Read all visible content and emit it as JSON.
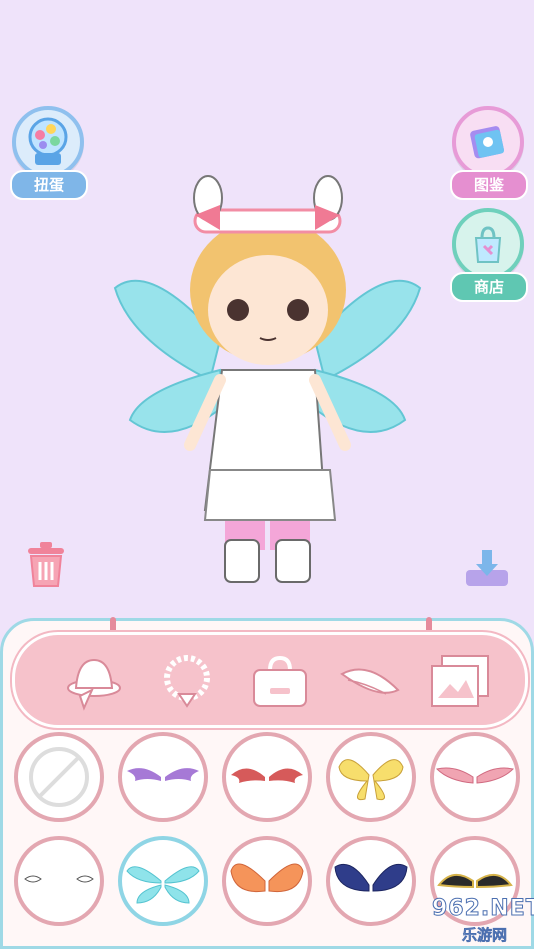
{
  "side_buttons": {
    "gacha_label": "扭蛋",
    "collection_label": "图鉴",
    "shop_label": "商店"
  },
  "categories": [
    "hat-icon",
    "necklace-icon",
    "bag-icon",
    "wings-icon",
    "background-icon"
  ],
  "items": [
    {
      "icon": "none-icon"
    },
    {
      "icon": "purple-bat-wings-icon"
    },
    {
      "icon": "red-bat-wings-icon"
    },
    {
      "icon": "yellow-butterfly-wings-icon"
    },
    {
      "icon": "pink-feather-wings-icon"
    },
    {
      "icon": "white-small-wings-icon"
    },
    {
      "icon": "cyan-fairy-wings-icon",
      "selected": true
    },
    {
      "icon": "orange-fairy-wings-icon"
    },
    {
      "icon": "navy-feather-wings-icon"
    },
    {
      "icon": "black-gold-wings-icon"
    }
  ],
  "watermark": {
    "brand": "962.NET",
    "sub": "乐游网"
  },
  "colors": {
    "background": "#efe3fa",
    "panel_border": "#9fd9e6",
    "category_bar": "#f6c2cb",
    "item_border": "#e3a7b1",
    "selected_border": "#8fd5e5"
  }
}
